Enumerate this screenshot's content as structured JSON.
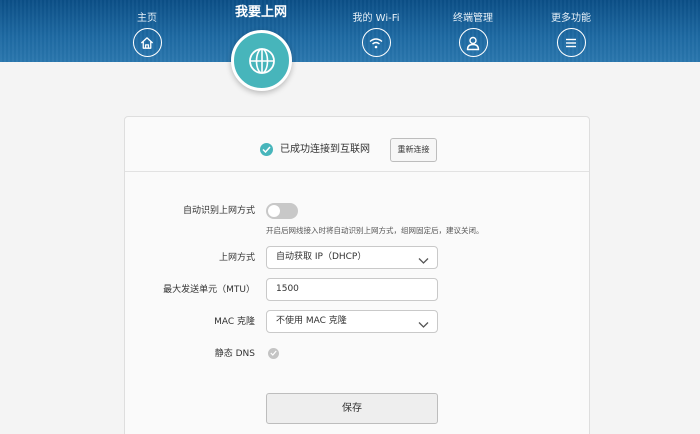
{
  "nav": {
    "items": [
      {
        "label": "主页",
        "icon": "home-icon"
      },
      {
        "label": "我要上网",
        "icon": "globe-icon"
      },
      {
        "label": "我的 Wi-Fi",
        "icon": "wifi-icon"
      },
      {
        "label": "终端管理",
        "icon": "user-icon"
      },
      {
        "label": "更多功能",
        "icon": "menu-icon"
      }
    ],
    "active_index": 1
  },
  "status": {
    "text": "已成功连接到互联网",
    "reconnect_label": "重新连接"
  },
  "form": {
    "auto_detect": {
      "label": "自动识别上网方式",
      "enabled": false,
      "hint": "开启后网线接入时将自动识别上网方式，组网固定后，建议关闭。"
    },
    "wan_mode": {
      "label": "上网方式",
      "value": "自动获取 IP（DHCP）"
    },
    "mtu": {
      "label": "最大发送单元（MTU）",
      "value": "1500"
    },
    "mac_clone": {
      "label": "MAC 克隆",
      "value": "不使用 MAC 克隆"
    },
    "static_dns": {
      "label": "静态 DNS",
      "checked": false
    },
    "save_label": "保存"
  },
  "colors": {
    "nav_bar": "#1e6aa3",
    "accent": "#47b5bb"
  }
}
